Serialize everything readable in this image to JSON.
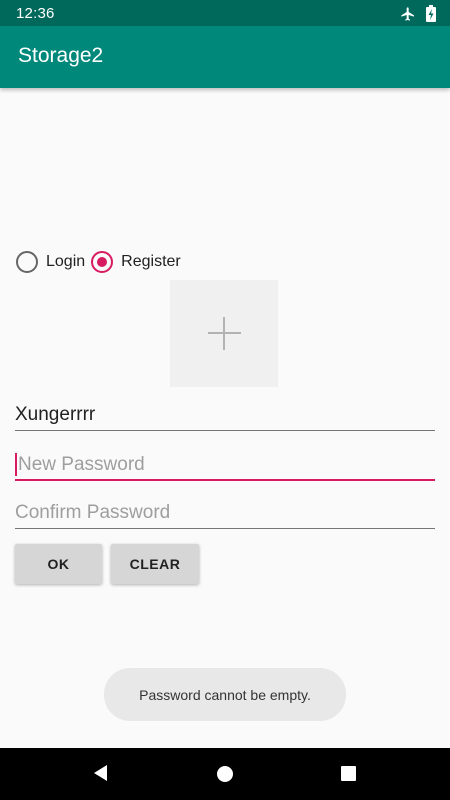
{
  "status_bar": {
    "time": "12:36",
    "icons": [
      "airplane-icon",
      "battery-charging-icon"
    ]
  },
  "app_bar": {
    "title": "Storage2",
    "color": "#00897b"
  },
  "mode_selector": {
    "options": [
      {
        "label": "Login",
        "checked": false
      },
      {
        "label": "Register",
        "checked": true
      }
    ]
  },
  "image_picker": {
    "icon": "plus-icon"
  },
  "form": {
    "username": {
      "value": "Xungerrrr"
    },
    "new_password": {
      "value": "",
      "placeholder": "New Password",
      "focused": true
    },
    "confirm_password": {
      "value": "",
      "placeholder": "Confirm Password"
    }
  },
  "buttons": {
    "ok_label": "OK",
    "clear_label": "CLEAR"
  },
  "toast": {
    "message": "Password cannot be empty."
  },
  "nav_bar": {
    "buttons": [
      "back-icon",
      "home-icon",
      "recents-icon"
    ]
  },
  "colors": {
    "status_bar": "#00695c",
    "accent": "#d81b60"
  }
}
